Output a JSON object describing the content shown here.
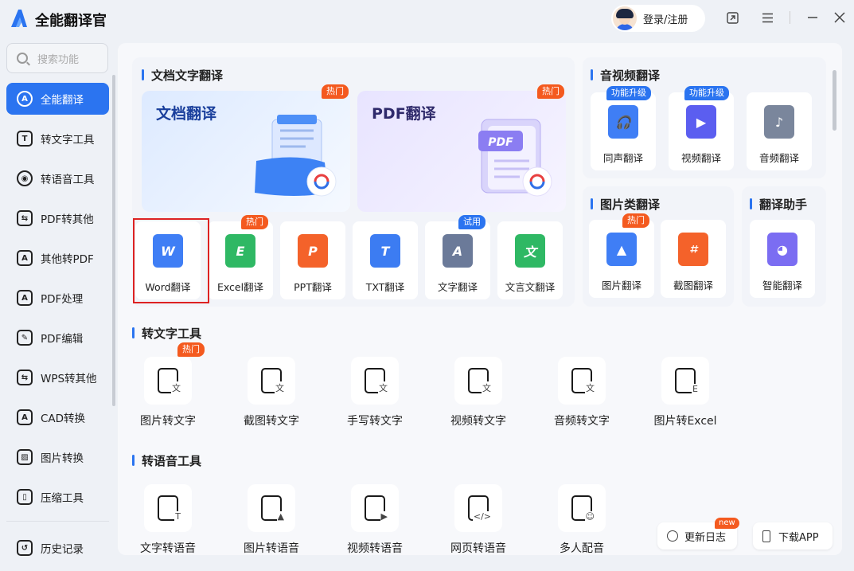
{
  "app": {
    "title": "全能翻译官"
  },
  "header": {
    "login_label": "登录/注册"
  },
  "sidebar": {
    "search_placeholder": "搜索功能",
    "items": [
      {
        "label": "全能翻译",
        "icon": "A",
        "name": "translate"
      },
      {
        "label": "转文字工具",
        "icon": "T",
        "name": "to-text"
      },
      {
        "label": "转语音工具",
        "icon": "◉",
        "name": "to-speech"
      },
      {
        "label": "PDF转其他",
        "icon": "⇆",
        "name": "pdf-convert"
      },
      {
        "label": "其他转PDF",
        "icon": "A",
        "name": "to-pdf"
      },
      {
        "label": "PDF处理",
        "icon": "A",
        "name": "pdf-process"
      },
      {
        "label": "PDF编辑",
        "icon": "✎",
        "name": "pdf-edit"
      },
      {
        "label": "WPS转其他",
        "icon": "⇆",
        "name": "wps-convert"
      },
      {
        "label": "CAD转换",
        "icon": "A",
        "name": "cad-convert"
      },
      {
        "label": "图片转换",
        "icon": "▨",
        "name": "image-convert"
      },
      {
        "label": "压缩工具",
        "icon": "▯",
        "name": "compress"
      }
    ],
    "history_label": "历史记录"
  },
  "doc_section": {
    "title": "文档文字翻译",
    "banners": [
      {
        "title": "文档翻译",
        "badge": "热门"
      },
      {
        "title": "PDF翻译",
        "badge": "热门"
      }
    ],
    "tiles": [
      {
        "label": "Word翻译",
        "glyph": "W",
        "color": "#3f7ef5",
        "badge": ""
      },
      {
        "label": "Excel翻译",
        "glyph": "E",
        "color": "#2fb864",
        "badge": "热门"
      },
      {
        "label": "PPT翻译",
        "glyph": "P",
        "color": "#f4622a",
        "badge": ""
      },
      {
        "label": "TXT翻译",
        "glyph": "T",
        "color": "#3c7cf2",
        "badge": ""
      },
      {
        "label": "文字翻译",
        "glyph": "A",
        "color": "#6b7a99",
        "badge": "试用"
      },
      {
        "label": "文言文翻译",
        "glyph": "文",
        "color": "#2fb864",
        "badge": ""
      }
    ]
  },
  "av_section": {
    "title": "音视频翻译",
    "tiles": [
      {
        "label": "同声翻译",
        "badge": "功能升级",
        "glyph": "🎧",
        "color": "#3f7ef5"
      },
      {
        "label": "视频翻译",
        "badge": "功能升级",
        "glyph": "▶",
        "color": "#5b5ef0"
      },
      {
        "label": "音频翻译",
        "badge": "",
        "glyph": "♪",
        "color": "#7a869c"
      }
    ]
  },
  "image_section": {
    "title": "图片类翻译",
    "tiles": [
      {
        "label": "图片翻译",
        "badge": "热门",
        "glyph": "▲",
        "color": "#3f7ef5"
      },
      {
        "label": "截图翻译",
        "badge": "",
        "glyph": "⌗",
        "color": "#f4622a"
      }
    ]
  },
  "assistant_section": {
    "title": "翻译助手",
    "tiles": [
      {
        "label": "智能翻译",
        "glyph": "◕",
        "color": "#7b6df2"
      }
    ]
  },
  "text_tools": {
    "title": "转文字工具",
    "items": [
      {
        "label": "图片转文字",
        "badge": "热门",
        "sub": "文"
      },
      {
        "label": "截图转文字",
        "badge": "",
        "sub": "文"
      },
      {
        "label": "手写转文字",
        "badge": "",
        "sub": "文"
      },
      {
        "label": "视频转文字",
        "badge": "",
        "sub": "文"
      },
      {
        "label": "音频转文字",
        "badge": "",
        "sub": "文"
      },
      {
        "label": "图片转Excel",
        "badge": "",
        "sub": "E"
      }
    ]
  },
  "speech_tools": {
    "title": "转语音工具",
    "items": [
      {
        "label": "文字转语音",
        "sub": "T"
      },
      {
        "label": "图片转语音",
        "sub": "▲"
      },
      {
        "label": "视频转语音",
        "sub": "▶"
      },
      {
        "label": "网页转语音",
        "sub": "</>"
      },
      {
        "label": "多人配音",
        "sub": "☺"
      }
    ]
  },
  "footer": {
    "changelog_label": "更新日志",
    "changelog_badge": "new",
    "download_label": "下载APP"
  }
}
